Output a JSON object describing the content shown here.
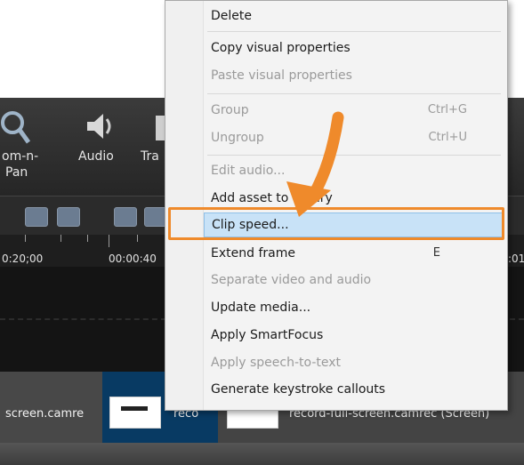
{
  "toolbar": {
    "tool_zoom_label_line1": "om-n-",
    "tool_zoom_label_line2": "Pan",
    "tool_audio_label": "Audio",
    "tool_transitions_label": "Tra"
  },
  "timeline": {
    "time_labels": [
      "0:20;00",
      "00:00:40",
      ":01"
    ]
  },
  "clips": {
    "clip1_name": "screen.camre",
    "clip2_name": "reco",
    "clip3_name": "record-full-screen.camrec (Screen)"
  },
  "context_menu": {
    "items": [
      {
        "label": "Delete",
        "shortcut": "",
        "enabled": true
      },
      {
        "label": "Copy visual properties",
        "shortcut": "",
        "enabled": true
      },
      {
        "label": "Paste visual properties",
        "shortcut": "",
        "enabled": false
      },
      {
        "label": "Group",
        "shortcut": "Ctrl+G",
        "enabled": false
      },
      {
        "label": "Ungroup",
        "shortcut": "Ctrl+U",
        "enabled": false
      },
      {
        "label": "Edit audio...",
        "shortcut": "",
        "enabled": false
      },
      {
        "label": "Add asset to library",
        "shortcut": "",
        "enabled": true
      },
      {
        "label": "Clip speed...",
        "shortcut": "",
        "enabled": true,
        "highlighted": true
      },
      {
        "label": "Extend frame",
        "shortcut": "E",
        "enabled": true
      },
      {
        "label": "Separate video and audio",
        "shortcut": "",
        "enabled": false
      },
      {
        "label": "Update media...",
        "shortcut": "",
        "enabled": true
      },
      {
        "label": "Apply SmartFocus",
        "shortcut": "",
        "enabled": true
      },
      {
        "label": "Apply speech-to-text",
        "shortcut": "",
        "enabled": false
      },
      {
        "label": "Generate keystroke callouts",
        "shortcut": "",
        "enabled": true
      }
    ]
  },
  "colors": {
    "highlight_outline": "#ef8a2b",
    "arrow": "#ef8a2b",
    "menu_highlight": "#c8e2f7",
    "selected_clip": "#083a63"
  }
}
